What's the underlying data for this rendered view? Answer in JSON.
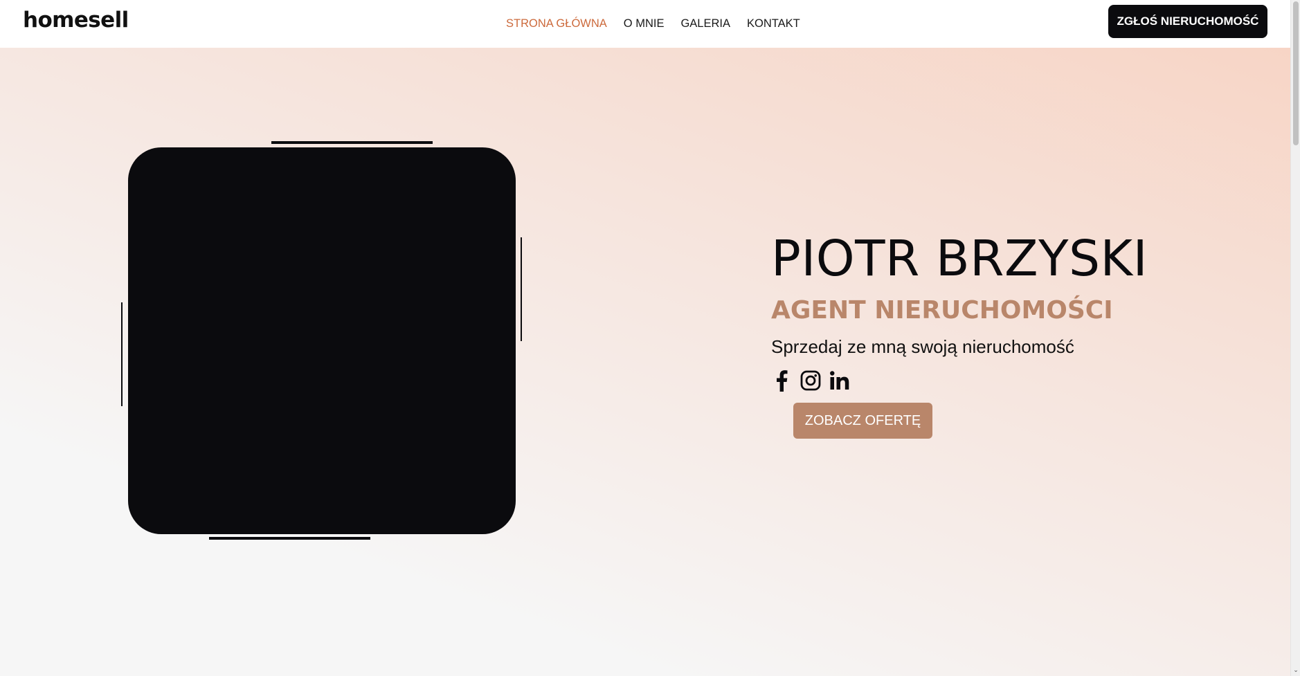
{
  "header": {
    "logo": "homesell",
    "nav": [
      {
        "label": "STRONA GŁÓWNA",
        "active": true
      },
      {
        "label": "O MNIE",
        "active": false
      },
      {
        "label": "GALERIA",
        "active": false
      },
      {
        "label": "KONTAKT",
        "active": false
      }
    ],
    "cta_label": "ZGŁOŚ NIERUCHOMOŚĆ"
  },
  "hero": {
    "name": "PIOTR BRZYSKI",
    "role": "AGENT NIERUCHOMOŚCI",
    "tagline": "Sprzedaj ze mną swoją nieruchomość",
    "socials": [
      {
        "icon": "facebook-icon"
      },
      {
        "icon": "instagram-icon"
      },
      {
        "icon": "linkedin-icon"
      }
    ],
    "cta_label": "ZOBACZ OFERTĘ"
  },
  "colors": {
    "accent": "#cc6a3c",
    "brand_tan": "#b9866a",
    "dark": "#0b0b0e",
    "hero_gradient_top": "#f7d5c6",
    "hero_gradient_bottom": "#f6f6f6"
  },
  "scrollbar": {
    "arrow": "⌄"
  }
}
